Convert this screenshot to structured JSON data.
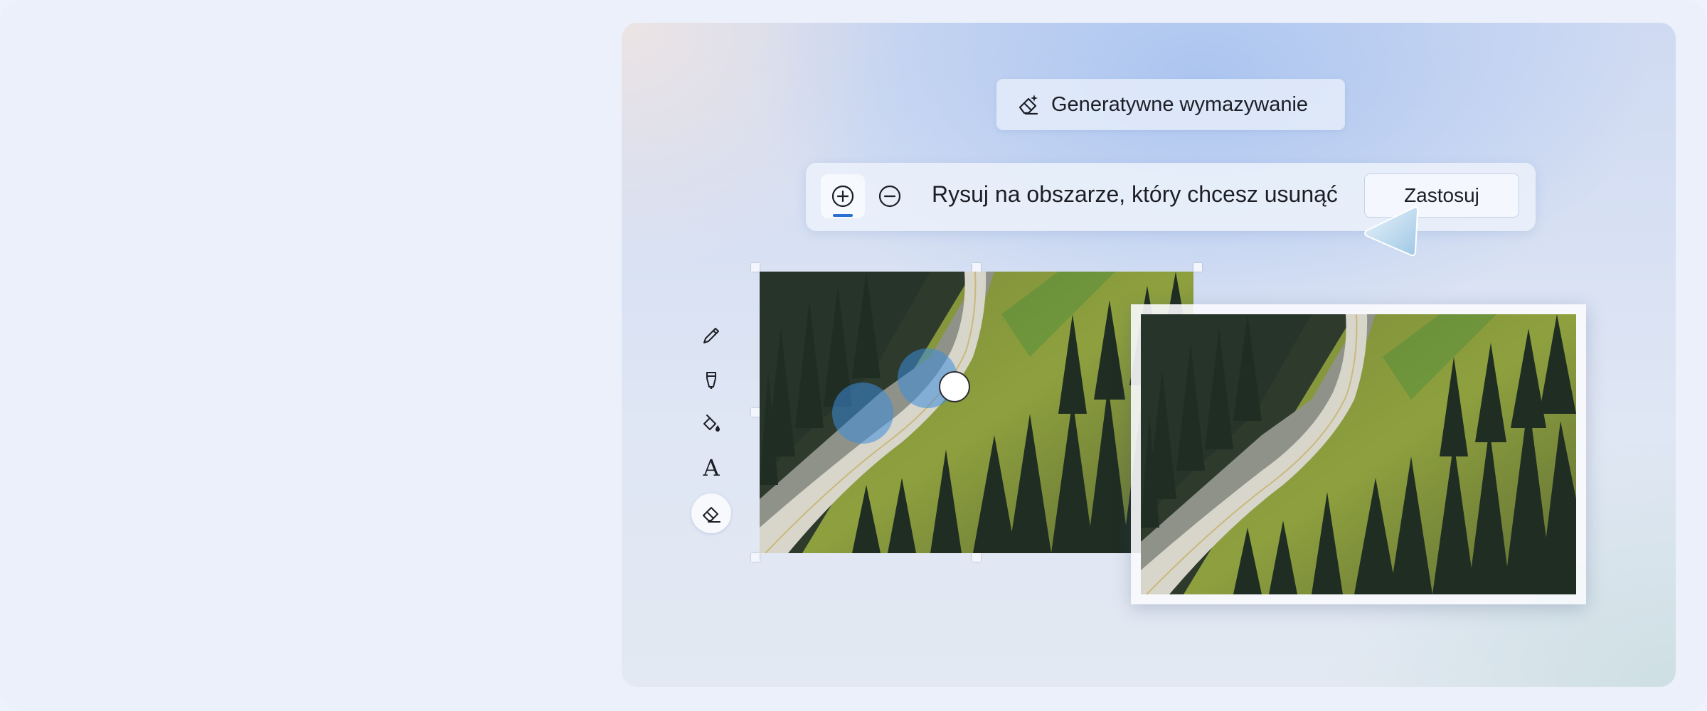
{
  "feature": {
    "title": "Generatywne wymazywanie",
    "icon": "magic-eraser-icon"
  },
  "toolbar": {
    "add_icon": "plus-circle-icon",
    "remove_icon": "minus-circle-icon",
    "hint": "Rysuj na obszarze, który chcesz usunąć",
    "apply_label": "Zastosuj",
    "accent_color": "#2b6fd1"
  },
  "side_tools": [
    {
      "name": "pen-icon"
    },
    {
      "name": "highlighter-icon"
    },
    {
      "name": "fill-bucket-icon"
    },
    {
      "name": "text-icon",
      "glyph": "A"
    },
    {
      "name": "eraser-icon",
      "active": true
    }
  ],
  "images": {
    "before": "mountain-road-with-cars",
    "after": "mountain-road-cars-removed"
  }
}
